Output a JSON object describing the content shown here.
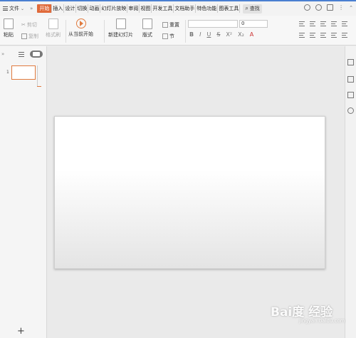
{
  "menu": {
    "file_label": "文件"
  },
  "tabs": [
    {
      "label": "开始",
      "active": true
    },
    {
      "label": "插入"
    },
    {
      "label": "设计"
    },
    {
      "label": "切换"
    },
    {
      "label": "动画"
    },
    {
      "label": "幻灯片放映"
    },
    {
      "label": "审阅"
    },
    {
      "label": "视图"
    },
    {
      "label": "开发工具"
    },
    {
      "label": "文档助手"
    },
    {
      "label": "特色功能"
    },
    {
      "label": "图表工具"
    }
  ],
  "search": {
    "label": "查找"
  },
  "ribbon": {
    "paste": "粘贴",
    "cut": "剪切",
    "copy": "复制",
    "format_painter": "格式刷",
    "play_from_current": "从当前开始",
    "new_slide": "新建幻灯片",
    "layout": "版式",
    "reset": "重置",
    "section": "节",
    "font_size": "0",
    "format_buttons": [
      "B",
      "I",
      "U",
      "S",
      "X²",
      "X₂",
      "A"
    ]
  },
  "slides": {
    "current_number": "1",
    "add_symbol": "+"
  },
  "watermark": {
    "brand": "Bai度 经验",
    "url": "jingyan.baidu.com"
  },
  "colors": {
    "accent": "#e06a3a",
    "titlebar_accent": "#4a7fd1"
  }
}
